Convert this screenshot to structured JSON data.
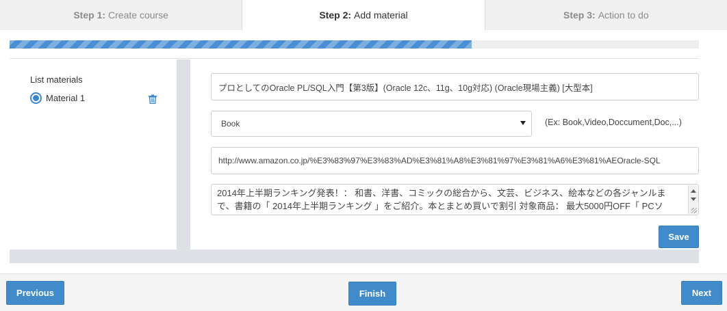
{
  "tabs": [
    {
      "step": "Step 1:",
      "label": "Create course",
      "active": false
    },
    {
      "step": "Step 2:",
      "label": "Add material",
      "active": true
    },
    {
      "step": "Step 3:",
      "label": "Action to do",
      "active": false
    }
  ],
  "progress": {
    "percent": 67,
    "color": "#4a8fd4"
  },
  "materials": {
    "title": "List materials",
    "items": [
      {
        "label": "Material 1",
        "selected": true,
        "delete_icon": "trash-icon"
      }
    ]
  },
  "form": {
    "title_value": "プロとしてのOracle PL/SQL入門【第3版】(Oracle 12c、11g、10g対応) (Oracle現場主義) [大型本]",
    "type_value": "Book",
    "type_hint": "(Ex: Book,Video,Doccument,Doc,...)",
    "url_value": "http://www.amazon.co.jp/%E3%83%97%E3%83%AD%E3%81%A8%E3%81%97%E3%81%A6%E3%81%AEOracle-SQL",
    "description_value": "2014年上半期ランキング発表！： 和書、洋書、コミックの総合から、文芸、ビジネス、絵本などの各ジャンルまで、書籍の「 2014年上半期ランキング 」をご紹介。本とまとめ買いで割引 対象商品： 最大5000円OFF「 PCソ"
  },
  "buttons": {
    "save": "Save",
    "previous": "Previous",
    "finish": "Finish",
    "next": "Next"
  },
  "colors": {
    "accent": "#428bca",
    "panel_bg": "#dde1e5"
  }
}
